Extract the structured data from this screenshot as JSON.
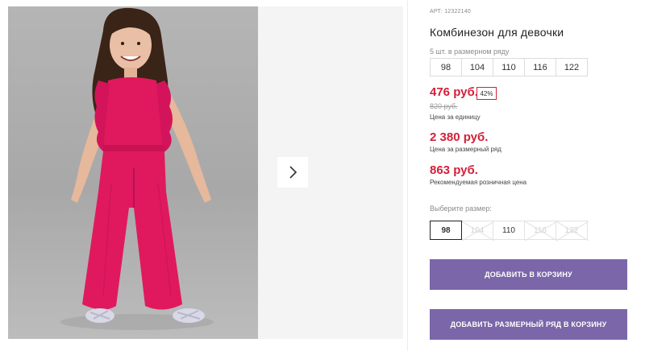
{
  "product": {
    "sku": "АРТ: 12322140",
    "title": "Комбинезон для девочки"
  },
  "size_run": {
    "label": "5 шт. в размерном ряду",
    "sizes": [
      "98",
      "104",
      "110",
      "116",
      "122"
    ]
  },
  "pricing": {
    "unit_price": "476 руб.",
    "discount": "42%",
    "old_price": "820 руб.",
    "unit_note": "Цена за единицу",
    "run_price": "2 380 руб.",
    "run_note": "Цена за размерный ряд",
    "retail_price": "863 руб.",
    "retail_note": "Рекомендуемая розничная цена"
  },
  "size_select": {
    "label": "Выберите размер:",
    "options": [
      {
        "size": "98",
        "state": "selected"
      },
      {
        "size": "104",
        "state": "disabled"
      },
      {
        "size": "110",
        "state": "available"
      },
      {
        "size": "116",
        "state": "disabled"
      },
      {
        "size": "122",
        "state": "disabled"
      }
    ]
  },
  "actions": {
    "add_to_cart": "ДОБАВИТЬ В КОРЗИНУ",
    "add_run_to_cart": "ДОБАВИТЬ РАЗМЕРНЫЙ РЯД В КОРЗИНУ"
  },
  "colors": {
    "accent_button": "#7a66a8",
    "price_red": "#d3203a",
    "garment": "#e0195e"
  },
  "icons": {
    "next": "chevron-right-icon"
  }
}
